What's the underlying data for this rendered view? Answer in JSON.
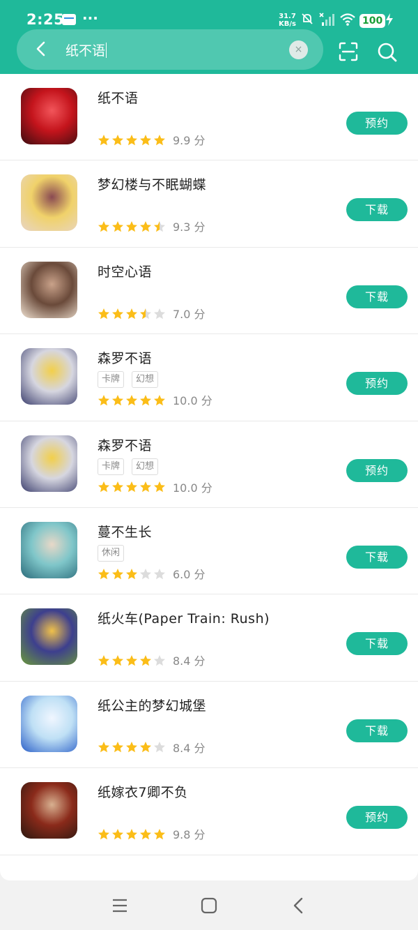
{
  "status_bar": {
    "time": "2:25",
    "more": "···",
    "net_speed_value": "31.7",
    "net_speed_unit": "KB/s",
    "battery": "100"
  },
  "search": {
    "query": "纸不语",
    "clear_glyph": "×"
  },
  "icons": {
    "back": "back-arrow-icon",
    "scan": "scan-icon",
    "search": "search-icon",
    "clear": "clear-icon",
    "star_full_color": "#fbbd18",
    "star_empty_color": "#dcdcdc"
  },
  "colors": {
    "accent": "#1fb99a",
    "text": "#222222",
    "muted": "#888888"
  },
  "results": [
    {
      "title": "纸不语",
      "tags": [],
      "stars": 5,
      "score": "9.9 分",
      "action": "预约"
    },
    {
      "title": "梦幻楼与不眠蝴蝶",
      "tags": [],
      "stars": 4.5,
      "score": "9.3 分",
      "action": "下载"
    },
    {
      "title": "时空心语",
      "tags": [],
      "stars": 3.5,
      "score": "7.0 分",
      "action": "下载"
    },
    {
      "title": "森罗不语",
      "tags": [
        "卡牌",
        "幻想"
      ],
      "stars": 5,
      "score": "10.0 分",
      "action": "预约"
    },
    {
      "title": "森罗不语",
      "tags": [
        "卡牌",
        "幻想"
      ],
      "stars": 5,
      "score": "10.0 分",
      "action": "预约"
    },
    {
      "title": "蔓不生长",
      "tags": [
        "休闲"
      ],
      "stars": 3,
      "score": "6.0 分",
      "action": "下载"
    },
    {
      "title": "纸火车(Paper Train: Rush)",
      "tags": [],
      "stars": 4,
      "score": "8.4 分",
      "action": "下载"
    },
    {
      "title": "纸公主的梦幻城堡",
      "tags": [],
      "stars": 4,
      "score": "8.4 分",
      "action": "下载"
    },
    {
      "title": "纸嫁衣7卿不负",
      "tags": [],
      "stars": 5,
      "score": "9.8 分",
      "action": "预约"
    }
  ]
}
